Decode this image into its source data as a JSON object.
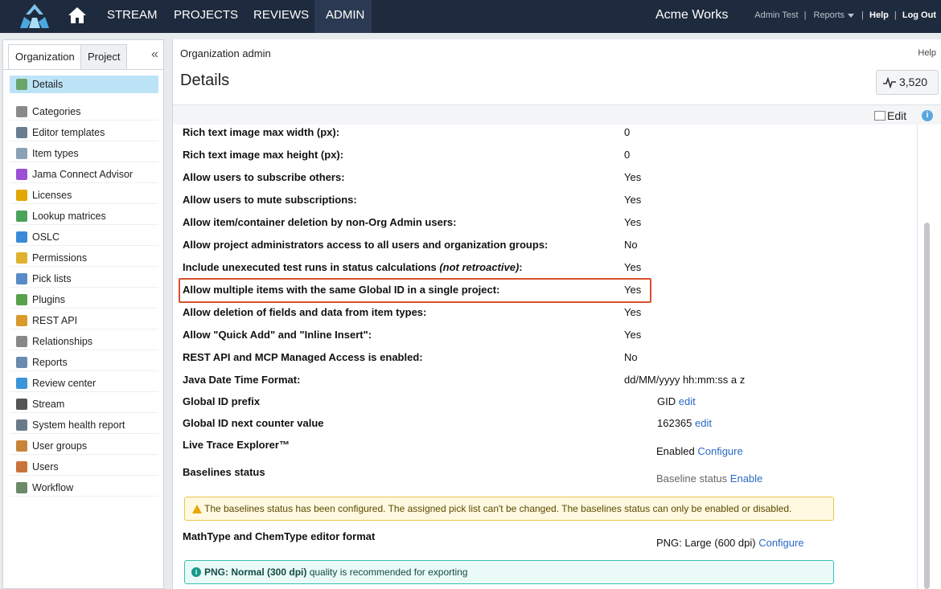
{
  "topnav": {
    "items": [
      "STREAM",
      "PROJECTS",
      "REVIEWS",
      "ADMIN"
    ],
    "brand": "Acme Works",
    "user": "Admin Test",
    "reports": "Reports",
    "help": "Help",
    "logout": "Log Out"
  },
  "sidebar": {
    "tabs": [
      "Organization",
      "Project"
    ],
    "items": [
      {
        "label": "Details",
        "icon": "details-icon",
        "color": "#6aa56a"
      },
      {
        "label": "Categories",
        "icon": "tag-icon",
        "color": "#8a8a8a"
      },
      {
        "label": "Editor templates",
        "icon": "template-icon",
        "color": "#6b7d90"
      },
      {
        "label": "Item types",
        "icon": "item-types-icon",
        "color": "#8aa0b5"
      },
      {
        "label": "Jama Connect Advisor",
        "icon": "advisor-icon",
        "color": "#9b4fd6"
      },
      {
        "label": "Licenses",
        "icon": "key-icon",
        "color": "#e0a800"
      },
      {
        "label": "Lookup matrices",
        "icon": "matrix-icon",
        "color": "#4aa35a"
      },
      {
        "label": "OSLC",
        "icon": "oslc-icon",
        "color": "#3a8ad8"
      },
      {
        "label": "Permissions",
        "icon": "shield-icon",
        "color": "#e0b030"
      },
      {
        "label": "Pick lists",
        "icon": "list-icon",
        "color": "#5a8ac8"
      },
      {
        "label": "Plugins",
        "icon": "puzzle-icon",
        "color": "#5aa24a"
      },
      {
        "label": "REST API",
        "icon": "api-icon",
        "color": "#d89a2a"
      },
      {
        "label": "Relationships",
        "icon": "link-icon",
        "color": "#888888"
      },
      {
        "label": "Reports",
        "icon": "chart-icon",
        "color": "#6a8ab0"
      },
      {
        "label": "Review center",
        "icon": "review-icon",
        "color": "#3a96d8"
      },
      {
        "label": "Stream",
        "icon": "stream-icon",
        "color": "#555555"
      },
      {
        "label": "System health report",
        "icon": "health-icon",
        "color": "#6a7a8a"
      },
      {
        "label": "User groups",
        "icon": "group-icon",
        "color": "#c8843a"
      },
      {
        "label": "Users",
        "icon": "user-icon",
        "color": "#c8743a"
      },
      {
        "label": "Workflow",
        "icon": "workflow-icon",
        "color": "#6a8a6a"
      }
    ]
  },
  "main": {
    "breadcrumb": "Organization admin",
    "help": "Help",
    "title": "Details",
    "counter": "3,520",
    "edit": "Edit",
    "settings": [
      {
        "label": "Rich text image max width (px):",
        "value": "0"
      },
      {
        "label": "Rich text image max height (px):",
        "value": "0"
      },
      {
        "label": "Allow users to subscribe others:",
        "value": "Yes"
      },
      {
        "label": "Allow users to mute subscriptions:",
        "value": "Yes"
      },
      {
        "label": "Allow item/container deletion by non-Org Admin users:",
        "value": "Yes"
      },
      {
        "label": "Allow project administrators access to all users and organization groups:",
        "value": "No"
      },
      {
        "label": "Include unexecuted test runs in status calculations",
        "label_note": "(not retroactive)",
        "label_suffix": ":",
        "value": "Yes"
      },
      {
        "label": "Allow multiple items with the same Global ID in a single project:",
        "value": "Yes"
      },
      {
        "label": "Allow deletion of fields and data from item types:",
        "value": "Yes"
      },
      {
        "label": "Allow \"Quick Add\" and \"Inline Insert\":",
        "value": "Yes"
      },
      {
        "label": "REST API and MCP Managed Access is enabled:",
        "value": "No"
      },
      {
        "label": "Java Date Time Format:",
        "value": "dd/MM/yyyy hh:mm:ss a z"
      }
    ],
    "global_id_prefix": {
      "label": "Global ID prefix",
      "value": "GID",
      "action": "edit"
    },
    "global_id_counter": {
      "label": "Global ID next counter value",
      "value": "162365",
      "action": "edit"
    },
    "live_trace": {
      "label": "Live Trace Explorer™",
      "value": "Enabled",
      "action": "Configure"
    },
    "baselines": {
      "label": "Baselines status",
      "value": "Baseline status",
      "action": "Enable"
    },
    "baselines_warning": "The baselines status has been configured. The assigned pick list can't be changed. The baselines status can only be enabled or disabled.",
    "mathtype": {
      "label": "MathType and ChemType editor format",
      "value": "PNG: Large (600 dpi)",
      "action": "Configure"
    },
    "mathtype_tip_bold": "PNG: Normal (300 dpi)",
    "mathtype_tip_rest": " quality is recommended for exporting"
  }
}
